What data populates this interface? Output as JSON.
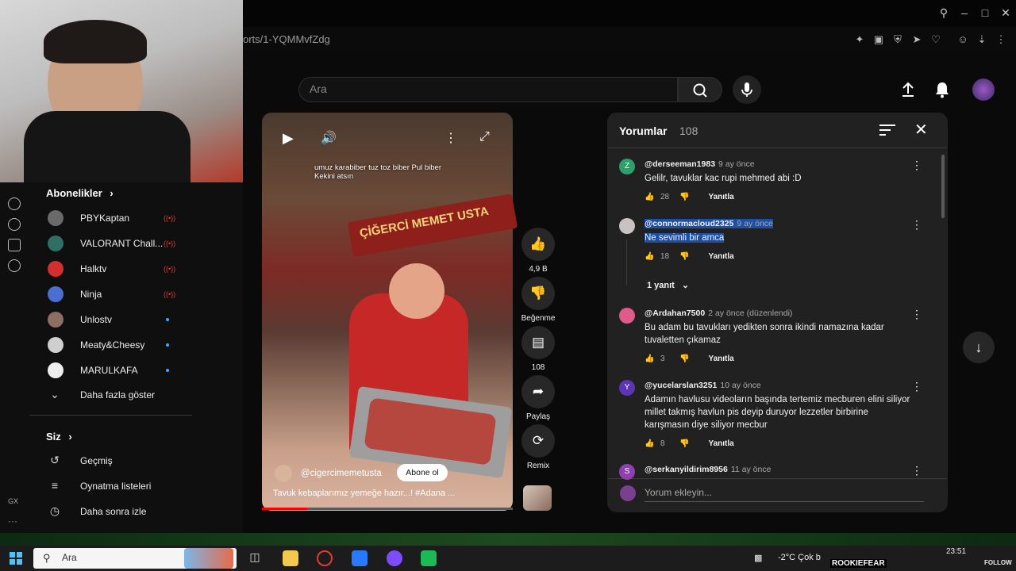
{
  "browser": {
    "url_fragment": "orts/1-YQMMvfZdg"
  },
  "header": {
    "search_placeholder": "Ara"
  },
  "sidebar": {
    "subscriptions_title": "Abonelikler",
    "subscriptions": [
      {
        "name": "PBYKaptan",
        "status": "live",
        "color": "#6a6a6a"
      },
      {
        "name": "VALORANT Chall...",
        "status": "live",
        "color": "#2f6f66"
      },
      {
        "name": "Halktv",
        "status": "live",
        "color": "#d32f2f"
      },
      {
        "name": "Ninja",
        "status": "live",
        "color": "#4a6fd1"
      },
      {
        "name": "Unlostv",
        "status": "new",
        "color": "#8d6e63"
      },
      {
        "name": "Meaty&Cheesy",
        "status": "new",
        "color": "#cfcfcf"
      },
      {
        "name": "MARULKAFA",
        "status": "new",
        "color": "#eeeeee"
      }
    ],
    "show_more": "Daha fazla göster",
    "you_title": "Siz",
    "you_items": [
      {
        "label": "Geçmiş",
        "icon": "history-icon"
      },
      {
        "label": "Oynatma listeleri",
        "icon": "playlists-icon"
      },
      {
        "label": "Daha sonra izle",
        "icon": "watch-later-icon"
      }
    ]
  },
  "video": {
    "caption": "umuz karabiber tuz toz biber Pul biber Kekini atsın",
    "sign_text": "ÇİĞERCİ MEMET USTA",
    "channel": "@cigercimemetusta",
    "subscribe_label": "Abone ol",
    "title": "Tavuk kebaplarımız yemeğe hazır...! #Adana ...",
    "progress_fraction": 0.18
  },
  "actions": {
    "like_count": "4,9 B",
    "dislike_label": "Beğenme",
    "comment_count": "108",
    "share_label": "Paylaş",
    "remix_label": "Remix"
  },
  "comments": {
    "title": "Yorumlar",
    "count": "108",
    "reply_label": "Yanıtla",
    "items": [
      {
        "author": "@derseeman1983",
        "time": "9 ay önce",
        "text": "Gelilr, tavuklar kac rupi mehmed abi :D",
        "likes": "28",
        "avatar_letter": "Z",
        "avatar_color": "#2e9e6b"
      },
      {
        "author": "@connormacloud2325",
        "time": "9 ay önce",
        "text": "Ne sevimli bir amca",
        "likes": "18",
        "avatar_letter": "",
        "avatar_color": "#c9c2c2"
      },
      {
        "author": "@Ardahan7500",
        "time": "2 ay önce (düzenlendi)",
        "text": "Bu adam bu tavukları yedikten sonra ikindi namazına kadar tuvaletten çıkamaz",
        "likes": "3",
        "avatar_letter": "",
        "avatar_color": "#e05a8a"
      },
      {
        "author": "@yucelarslan3251",
        "time": "10 ay önce",
        "text": "Adamın havlusu videoların başında tertemiz mecburen elini siliyor millet takmış havlun pis deyip duruyor lezzetler birbirine karışmasın diye siliyor mecbur",
        "likes": "8",
        "avatar_letter": "Y",
        "avatar_color": "#5c35b5"
      },
      {
        "author": "@serkanyildirim8956",
        "time": "11 ay önce",
        "text": "",
        "likes": "",
        "avatar_letter": "S",
        "avatar_color": "#8e3fb0"
      }
    ],
    "replies_toggle": "1 yanıt",
    "add_placeholder": "Yorum ekleyin..."
  },
  "taskbar": {
    "search_text": "Ara",
    "weather": "-2°C  Çok b",
    "overlay_name": "ROOKIEFEAR",
    "time": "23:51",
    "follow": "FOLLOW"
  }
}
